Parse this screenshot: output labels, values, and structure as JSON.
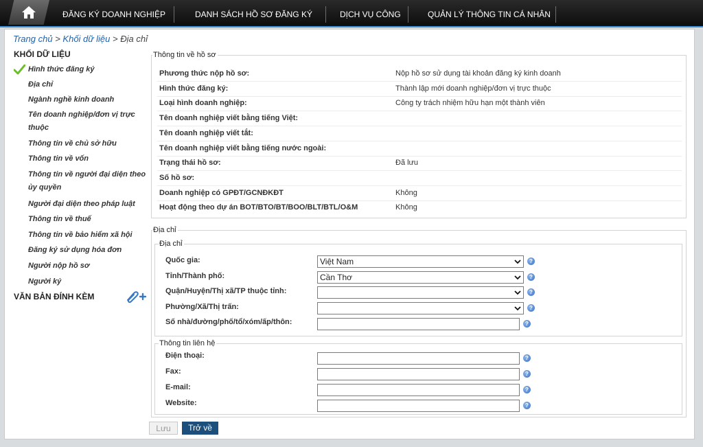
{
  "nav": {
    "items": [
      "ĐĂNG KÝ DOANH NGHIỆP",
      "DANH SÁCH HỒ SƠ ĐĂNG KÝ",
      "DỊCH VỤ CÔNG",
      "QUẢN LÝ THÔNG TIN CÁ NHÂN"
    ]
  },
  "breadcrumb": {
    "home": "Trang chủ",
    "sep": ">",
    "level2": "Khối dữ liệu",
    "current": "Địa chỉ"
  },
  "sidebar": {
    "title": "KHỐI DỮ LIỆU",
    "items": [
      {
        "label": "Hình thức đăng ký",
        "checked": true
      },
      {
        "label": "Địa chỉ"
      },
      {
        "label": "Ngành nghề kinh doanh"
      },
      {
        "label": "Tên doanh nghiệp/đơn vị trực thuộc"
      },
      {
        "label": "Thông tin về chủ sở hữu"
      },
      {
        "label": "Thông tin về vốn"
      },
      {
        "label": "Thông tin về người đại diện theo ủy quyền"
      },
      {
        "label": "Người đại diện theo pháp luật"
      },
      {
        "label": "Thông tin về thuế"
      },
      {
        "label": "Thông tin về bảo hiểm xã hội"
      },
      {
        "label": "Đăng ký sử dụng hóa đơn"
      },
      {
        "label": "Người nộp hồ sơ"
      },
      {
        "label": "Người ký"
      }
    ],
    "attachments_title": "VĂN BẢN ĐÍNH KÈM"
  },
  "profile": {
    "legend": "Thông tin về hồ sơ",
    "rows": [
      {
        "label": "Phương thức nộp hồ sơ:",
        "value": "Nộp hồ sơ sử dụng tài khoản đăng ký kinh doanh"
      },
      {
        "label": "Hình thức đăng ký:",
        "value": "Thành lập mới doanh nghiệp/đơn vị trực thuộc"
      },
      {
        "label": "Loại hình doanh nghiệp:",
        "value": "Công ty trách nhiệm hữu hạn một thành viên"
      },
      {
        "label": "Tên doanh nghiệp viết bằng tiếng Việt:",
        "value": ""
      },
      {
        "label": "Tên doanh nghiệp viết tắt:",
        "value": ""
      },
      {
        "label": "Tên doanh nghiệp viết bằng tiếng nước ngoài:",
        "value": ""
      },
      {
        "label": "Trạng thái hồ sơ:",
        "value": "Đã lưu"
      },
      {
        "label": "Số hồ sơ:",
        "value": ""
      },
      {
        "label": "Doanh nghiệp có GPĐT/GCNĐKĐT",
        "value": "Không"
      },
      {
        "label": "Hoạt động theo dự án BOT/BTO/BT/BOO/BLT/BTL/O&M",
        "value": "Không"
      }
    ]
  },
  "address": {
    "legend": "Địa chỉ",
    "inner_legend": "Địa chỉ",
    "fields": [
      {
        "label": "Quốc gia:",
        "value": "Việt Nam",
        "type": "select"
      },
      {
        "label": "Tỉnh/Thành phố:",
        "value": "Cần Thơ",
        "type": "select"
      },
      {
        "label": "Quận/Huyện/Thị xã/TP thuộc tỉnh:",
        "value": "",
        "type": "select"
      },
      {
        "label": "Phường/Xã/Thị trấn:",
        "value": "",
        "type": "select"
      },
      {
        "label": "Số nhà/đường/phố/tổ/xóm/ấp/thôn:",
        "value": "",
        "type": "text"
      }
    ]
  },
  "contact": {
    "legend": "Thông tin liên hệ",
    "fields": [
      {
        "label": "Điện thoại:",
        "value": ""
      },
      {
        "label": "Fax:",
        "value": ""
      },
      {
        "label": "E-mail:",
        "value": ""
      },
      {
        "label": "Website:",
        "value": ""
      }
    ]
  },
  "buttons": {
    "save": "Lưu",
    "back": "Trở về"
  },
  "help_glyph": "?",
  "colors": {
    "nav_bg": "#111111",
    "link": "#2462a8",
    "check": "#6cbf2b",
    "back_button": "#1d4f7c",
    "help_icon": "#3b6fc0"
  }
}
